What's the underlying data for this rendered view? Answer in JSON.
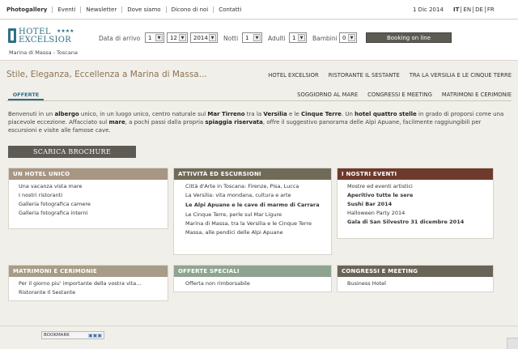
{
  "topnav": {
    "items": [
      "Photogallery",
      "Eventi",
      "Newsletter",
      "Dove siamo",
      "Dicono di noi",
      "Contatti"
    ],
    "date": "1 Dic 2014",
    "languages": [
      "IT",
      "EN",
      "DE",
      "FR"
    ]
  },
  "logo": {
    "hotel": "HOTEL",
    "stars": "★★★★",
    "name": "EXCELSIOR",
    "place": "Marina di Massa - Toscana"
  },
  "booking": {
    "arrival_label": "Data di arrivo",
    "day": "1",
    "month": "12",
    "year": "2014",
    "nights_label": "Notti",
    "nights": "1",
    "adults_label": "Adulti",
    "adults": "1",
    "children_label": "Bambini",
    "children": "0",
    "button": "Booking on line"
  },
  "slogan": "Stile, Eleganza, Eccellenza a Marina di Massa...",
  "mainnav": [
    "HOTEL EXCELSIOR",
    "RISTORANTE IL SESTANTE",
    "TRA LA VERSILIA E LE CINQUE TERRE"
  ],
  "subnav": {
    "active_tab": "OFFERTE",
    "items": [
      "SOGGIORNO AL MARE",
      "CONGRESSI E MEETING",
      "MATRIMONI E CERIMONIE"
    ]
  },
  "intro": {
    "p1a": "Benvenuti in un ",
    "p1b": "albergo",
    "p1c": " unico, in un luogo unico, centro naturale sul ",
    "p1d": "Mar Tirreno",
    "p1e": " tra la ",
    "p1f": "Versilia",
    "p1g": " e le ",
    "p1h": "Cinque Terre",
    "p1i": ". Un ",
    "p1j": "hotel quattro stelle",
    "p1k": " in grado di proporsi come una piacevole eccezione. Affacciato sul ",
    "p1l": "mare",
    "p1m": ", a pochi passi dalla propria ",
    "p1n": "spiaggia riservata",
    "p1o": ", offre il suggestivo panorama delle Alpi Apuane, facilmente raggiungibili per escursioni e visite alle famose cave."
  },
  "brochure_button": "SCARICA BROCHURE",
  "boxes": {
    "unico": {
      "title": "UN HOTEL UNICO",
      "color": "#a89684",
      "items": [
        "Una vacanza vista mare",
        "I nostri ristoranti",
        "Galleria fotografica camere",
        "Galleria fotografica interni"
      ]
    },
    "attivita": {
      "title": "ATTIVITÀ ED ESCURSIONI",
      "color": "#706a58",
      "items": [
        "Città d'Arte in Toscana: Firenze, Pisa, Lucca",
        "La Versilia: vita mondana, cultura e arte",
        "Le Alpi Apuane e le cave di marmo di Carrara",
        "Le Cinque Terre, perle sul Mar Ligure",
        "Marina di Massa, tra la Versilia e le Cinque Terre",
        "Massa, alle pendici delle Alpi Apuane"
      ]
    },
    "eventi": {
      "title": "I NOSTRI EVENTI",
      "color": "#6e3a2c",
      "items": [
        "Mostre ed eventi artistici",
        "Aperitivo tutte le sere",
        "Sushi Bar 2014",
        "Halloween Party 2014",
        "Gala di San Silvestro 31 dicembre 2014"
      ]
    },
    "matrimoni": {
      "title": "MATRIMONI E CERIMONIE",
      "color": "#a79c87",
      "items": [
        "Per il giorno piu' importante della vostra vita...",
        "Ristorante Il Sestante"
      ]
    },
    "offerte": {
      "title": "OFFERTE SPECIALI",
      "color": "#8fa391",
      "items": [
        "Offerta non rimborsabile"
      ]
    },
    "congressi": {
      "title": "CONGRESSI E MEETING",
      "color": "#6a6458",
      "items": [
        "Business Hotel"
      ]
    }
  },
  "bookmark": "BOOKMARK"
}
